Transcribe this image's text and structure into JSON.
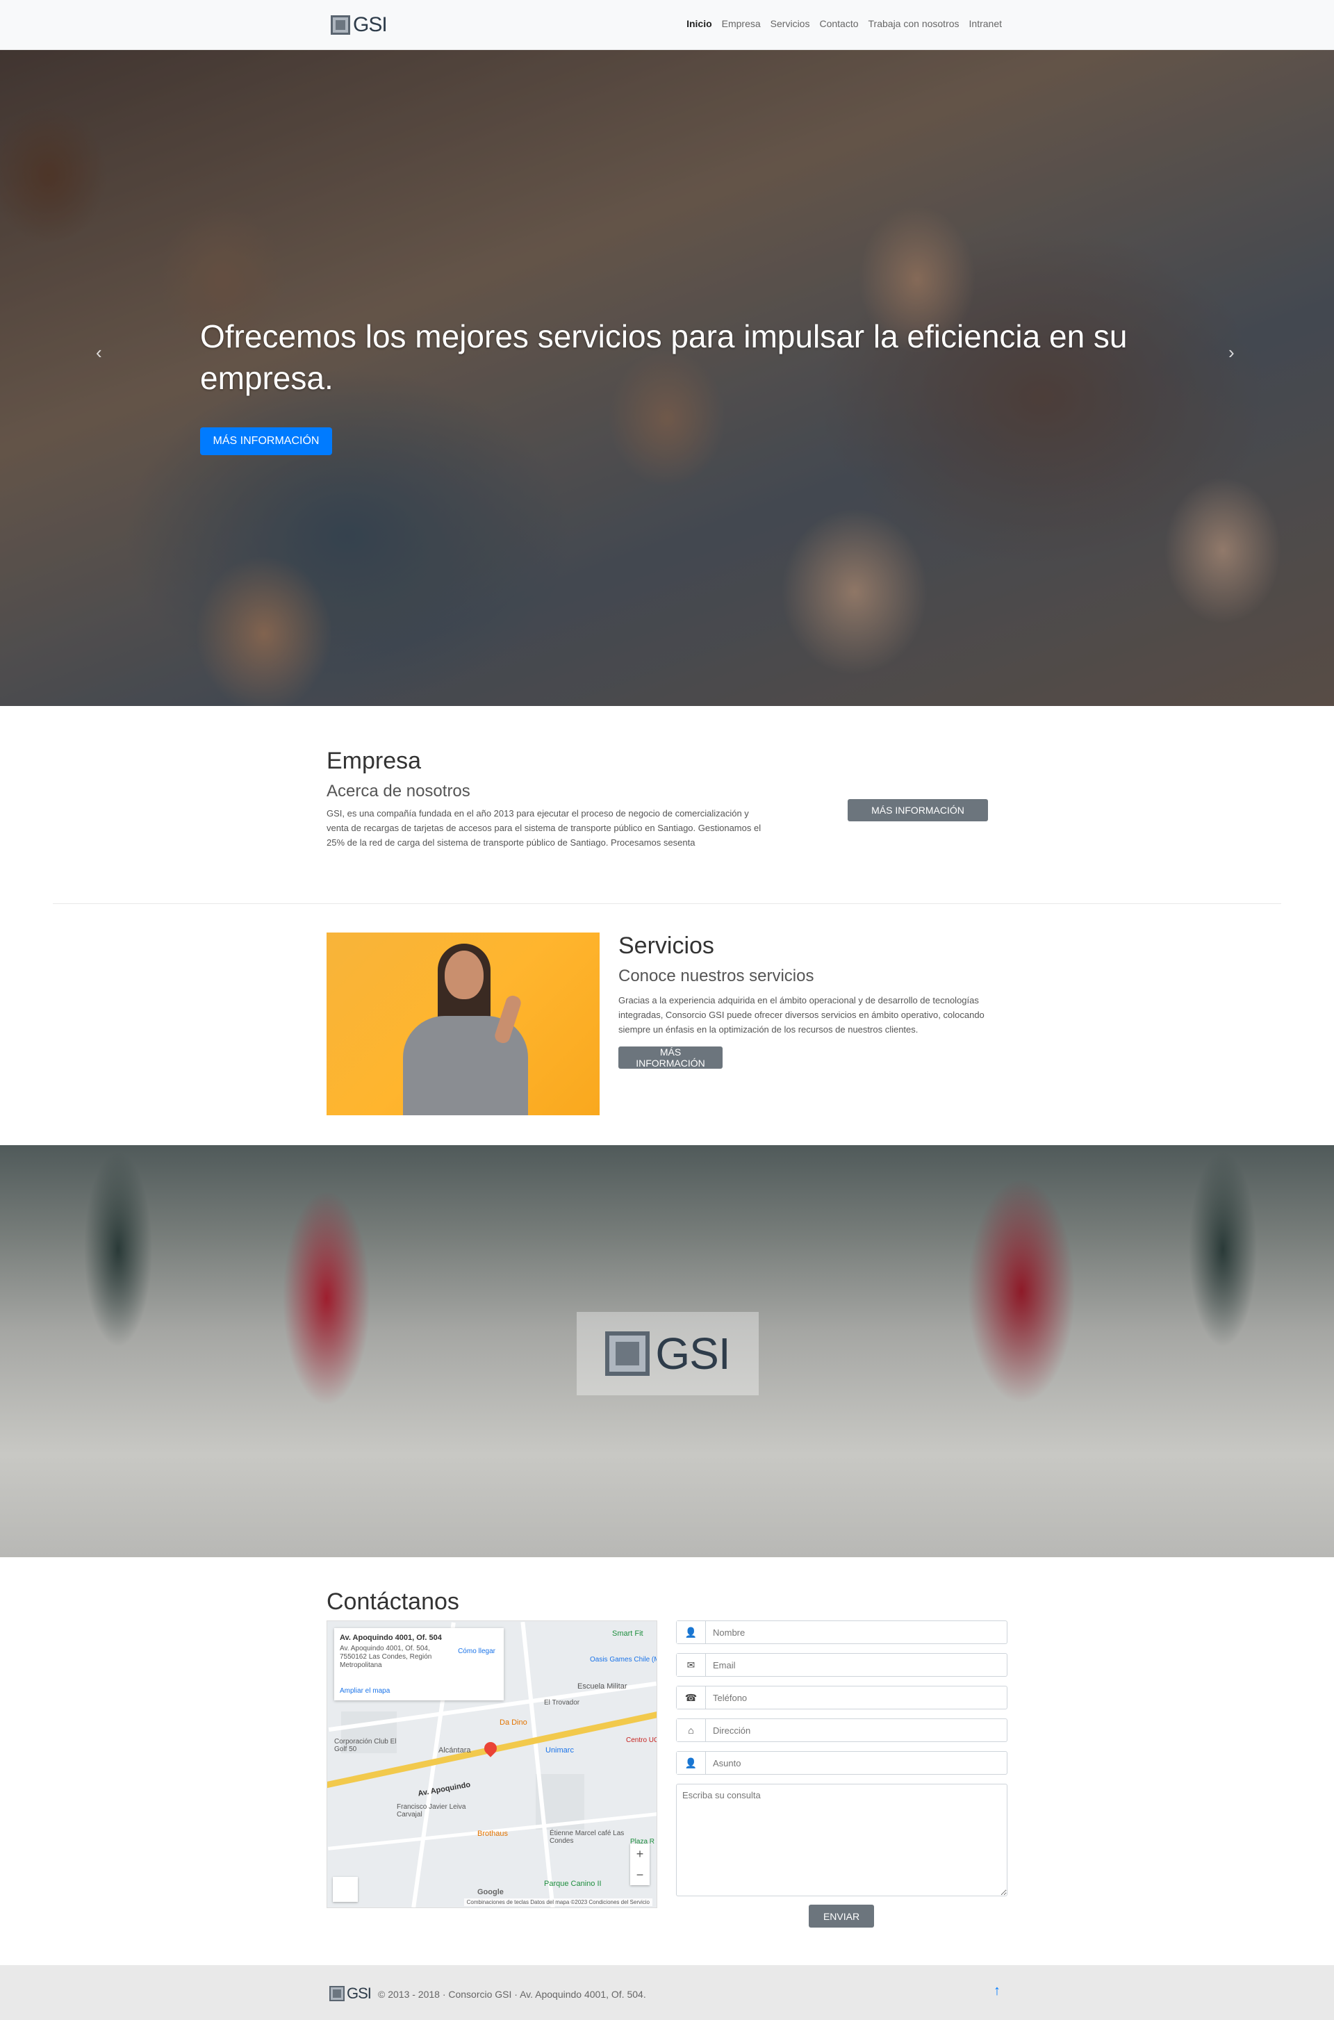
{
  "nav": {
    "logo_text": "GSI",
    "items": [
      {
        "label": "Inicio",
        "active": true
      },
      {
        "label": "Empresa",
        "active": false
      },
      {
        "label": "Servicios",
        "active": false
      },
      {
        "label": "Contacto",
        "active": false
      },
      {
        "label": "Trabaja con nosotros",
        "active": false
      },
      {
        "label": "Intranet",
        "active": false
      }
    ]
  },
  "hero": {
    "title": "Ofrecemos los mejores servicios para impulsar la eficiencia en su empresa.",
    "button": "MÁS INFORMACIÓN",
    "prev_icon": "‹",
    "next_icon": "›"
  },
  "empresa": {
    "title": "Empresa",
    "subtitle": "Acerca de nosotros",
    "text": "GSI, es una compañía fundada en el año 2013 para ejecutar el proceso de negocio de comercialización y venta de recargas de tarjetas de accesos para el sistema de transporte público en Santiago. Gestionamos el 25% de la red de carga del sistema de transporte público de Santiago. Procesamos sesenta",
    "button": "MÁS INFORMACIÓN"
  },
  "servicios": {
    "title": "Servicios",
    "subtitle": "Conoce nuestros servicios",
    "text": "Gracias a la experiencia adquirida en el ámbito operacional y de desarrollo de tecnologías integradas, Consorcio GSI puede ofrecer diversos servicios en ámbito operativo, colocando siempre un énfasis en la optimización de los recursos de nuestros clientes.",
    "button": "MÁS INFORMACIÓN"
  },
  "banner": {
    "logo_text": "GSI"
  },
  "contact": {
    "title": "Contáctanos",
    "map": {
      "card_title": "Av. Apoquindo 4001, Of. 504",
      "card_address": "Av. Apoquindo 4001, Of. 504, 7550162 Las Condes, Región Metropolitana",
      "card_directions": "Cómo llegar",
      "card_link": "Ampliar el mapa",
      "labels": [
        "Smart Fit",
        "Oasis Games Chile (MTG Oasis)",
        "Escuela Militar",
        "El Trovador",
        "Da Dino",
        "Unimarc",
        "Centro UC CH",
        "Corporación Club El Golf 50",
        "Alcántara",
        "Av. Apoquindo",
        "Francisco Javier Leiva Carvajal",
        "Brothaus",
        "Étienne Marcel café Las Condes",
        "Parque Canino II",
        "Plaza R"
      ],
      "zoom_in": "+",
      "zoom_out": "−",
      "google": "Google",
      "footer": "Combinaciones de teclas   Datos del mapa ©2023   Condiciones del Servicio"
    },
    "form": {
      "name_placeholder": "Nombre",
      "email_placeholder": "Email",
      "phone_placeholder": "Teléfono",
      "address_placeholder": "Dirección",
      "subject_placeholder": "Asunto",
      "message_placeholder": "Escriba su consulta",
      "send": "ENVIAR"
    }
  },
  "footer": {
    "logo_text": "GSI",
    "text": "© 2013 - 2018 · Consorcio GSI · Av. Apoquindo 4001, Of. 504.",
    "up_icon": "↑"
  }
}
